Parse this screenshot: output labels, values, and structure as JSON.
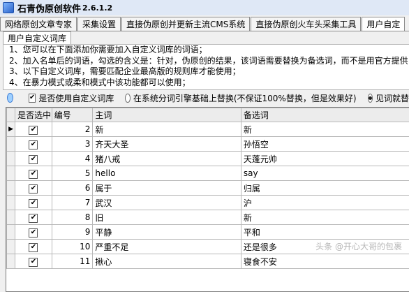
{
  "window": {
    "title": "石青伪原创软件",
    "version": "2.6.1.2"
  },
  "tabs": [
    {
      "label": "网络原创文章专家"
    },
    {
      "label": "采集设置"
    },
    {
      "label": "直接伪原创并更新主流CMS系统"
    },
    {
      "label": "直接伪原创火车头采集工具"
    },
    {
      "label": "用户自定"
    }
  ],
  "subtab": {
    "label": "用户自定义词库"
  },
  "info": {
    "lines": [
      "1、您可以在下面添加你需要加入自定义词库的词语；",
      "2、加入名单后的词语，勾选的含义是：针对，伪原创的结果，该词语需要替换为备选词，而不是用官方提供",
      "3、以下自定义词库，需要匹配企业最高版的规则库才能使用；",
      "4、在暴力模式或柔和模式中该功能都可以使用；"
    ]
  },
  "options": {
    "use_custom_label": "是否使用自定义词库",
    "use_custom_checked": true,
    "radio1_label": "在系统分词引擎基础上替换(不保证100%替换，但是效果好)",
    "radio2_label": "见词就替"
  },
  "grid": {
    "headers": [
      "是否选中",
      "编号",
      "主词",
      "备选词"
    ],
    "rows": [
      {
        "checked": true,
        "id": "2",
        "main": "新",
        "alt": "新"
      },
      {
        "checked": true,
        "id": "3",
        "main": "齐天大圣",
        "alt": "孙悟空"
      },
      {
        "checked": true,
        "id": "4",
        "main": "猪八戒",
        "alt": "天蓬元帅"
      },
      {
        "checked": true,
        "id": "5",
        "main": "hello",
        "alt": "say"
      },
      {
        "checked": true,
        "id": "6",
        "main": "属于",
        "alt": "归属"
      },
      {
        "checked": true,
        "id": "7",
        "main": "武汉",
        "alt": "沪"
      },
      {
        "checked": true,
        "id": "8",
        "main": "旧",
        "alt": "新"
      },
      {
        "checked": true,
        "id": "9",
        "main": "平静",
        "alt": "平和"
      },
      {
        "checked": true,
        "id": "10",
        "main": "严重不足",
        "alt": "还是很多"
      },
      {
        "checked": true,
        "id": "11",
        "main": "揪心",
        "alt": "寝食不安"
      }
    ]
  },
  "watermark": "头条 @开心大哥的包裹"
}
